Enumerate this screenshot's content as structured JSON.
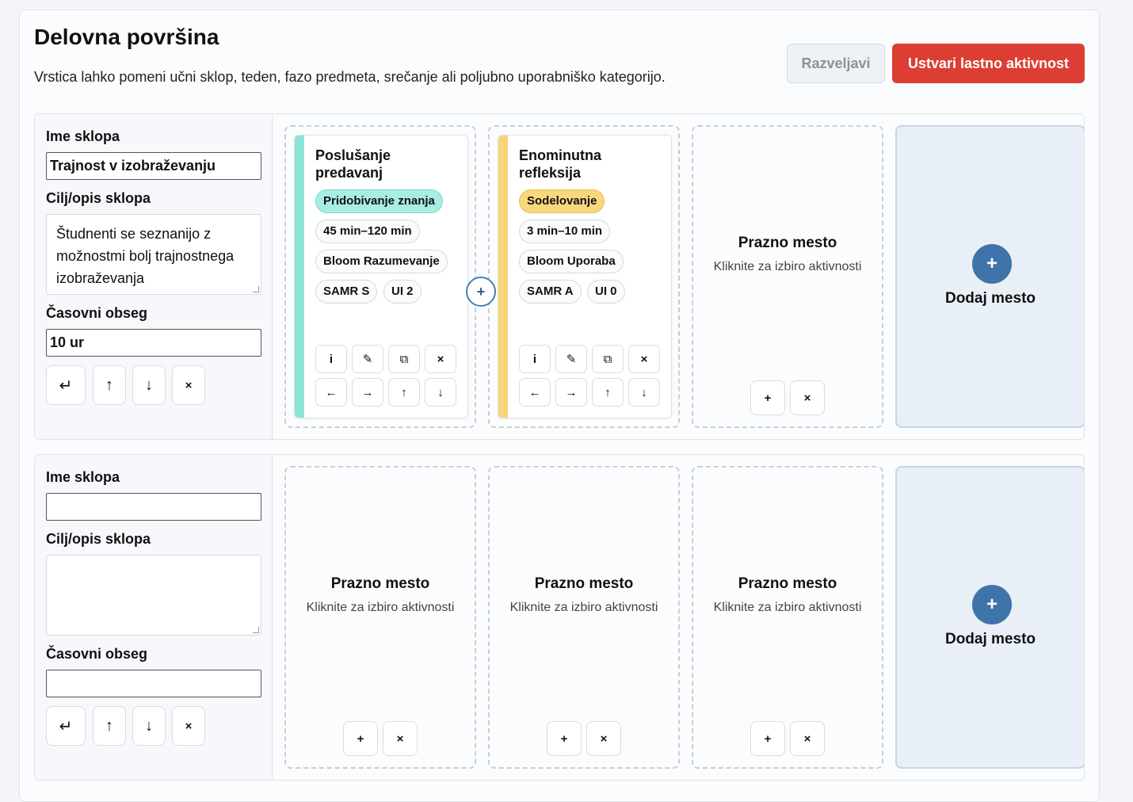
{
  "header": {
    "title": "Delovna površina",
    "subtitle": "Vrstica lahko pomeni učni sklop, teden, fazo predmeta, srečanje ali poljubno uporabniško kategorijo.",
    "undo_label": "Razveljavi",
    "create_label": "Ustvari lastno aktivnost"
  },
  "colors": {
    "accent": "#dc3e33",
    "teal": "#8ee3d9",
    "yellow": "#f7d67a",
    "blue": "#3f74a8"
  },
  "labels": {
    "unit_name": "Ime sklopa",
    "unit_goal": "Cilj/opis sklopa",
    "time_span": "Časovni obseg",
    "empty_title": "Prazno mesto",
    "empty_sub": "Kliknite za izbiro aktivnosti",
    "add_slot": "Dodaj mesto",
    "plus": "+",
    "x": "×",
    "enter": "↵",
    "up": "↑",
    "down": "↓",
    "left": "←",
    "right": "→",
    "info": "i",
    "edit": "✎",
    "copy": "⧉"
  },
  "rows": [
    {
      "name": "Trajnost v izobraževanju",
      "goal": "Študnenti se seznanijo z možnostmi bolj trajnostnega izobraževanja",
      "time": "10 ur",
      "cards": [
        {
          "title": "Poslušanje predavanj",
          "category": "Pridobivanje znanja",
          "duration": "45 min–120 min",
          "bloom": "Bloom Razumevanje",
          "samr": "SAMR S",
          "ui": "UI 2"
        },
        {
          "title": "Enominutna refleksija",
          "category": "Sodelovanje",
          "duration": "3 min–10 min",
          "bloom": "Bloom Uporaba",
          "samr": "SAMR A",
          "ui": "UI 0"
        }
      ]
    },
    {
      "name": "",
      "goal": "",
      "time": "",
      "cards": []
    }
  ]
}
